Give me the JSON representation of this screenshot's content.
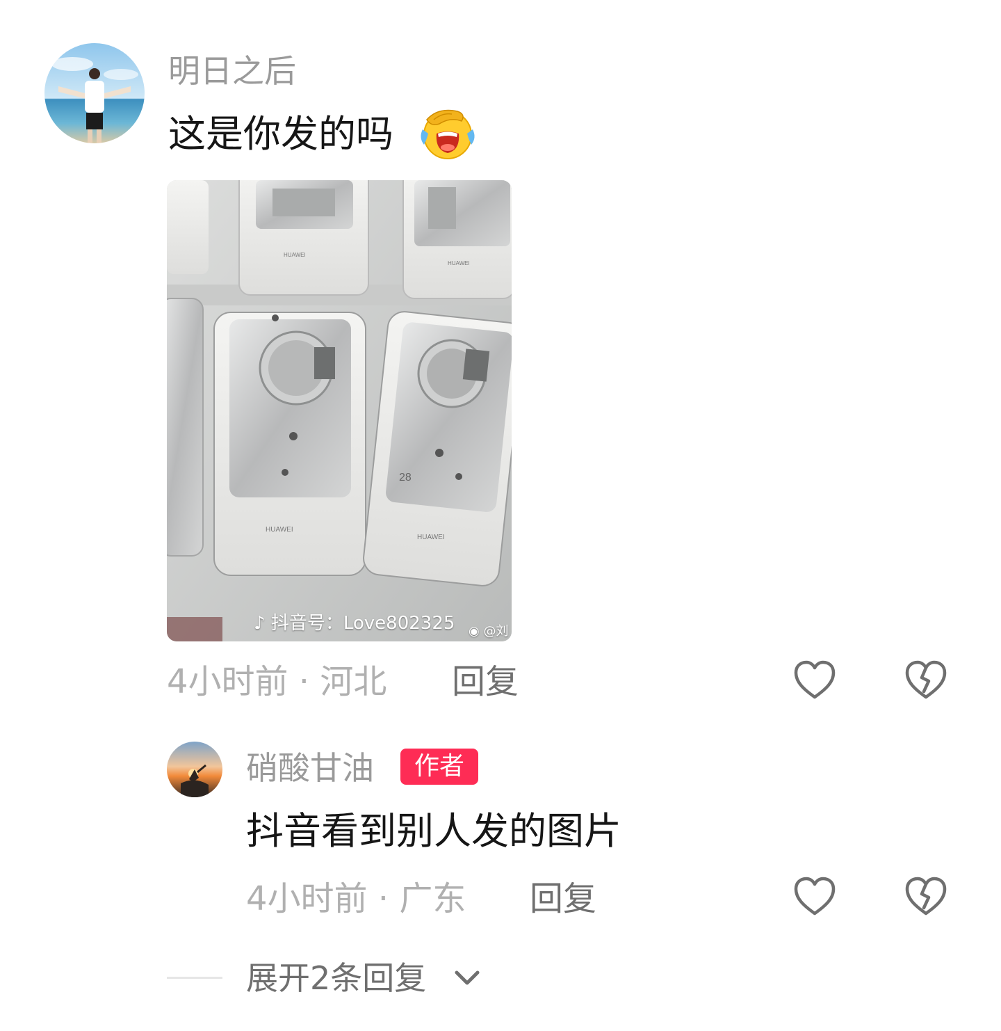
{
  "comments": [
    {
      "username": "明日之后",
      "text": "这是你发的吗",
      "emoji": "facepalm-laugh-emoji",
      "image": {
        "product_label": "HUAWEI",
        "unit_number": "28",
        "watermark": "抖音号：Love802325",
        "watermark2": "@刘"
      },
      "meta": "4小时前 · 河北",
      "reply_label": "回复"
    },
    {
      "username": "硝酸甘油",
      "badge": "作者",
      "text": "抖音看到别人发的图片",
      "meta": "4小时前 · 广东",
      "reply_label": "回复"
    }
  ],
  "expand_label": "展开2条回复",
  "icons": {
    "like": "heart-outline-icon",
    "dislike": "broken-heart-icon",
    "expand": "chevron-down-icon"
  },
  "colors": {
    "author_badge": "#fe2c55",
    "primary_text": "#161616",
    "secondary_text": "#b0b0b0"
  }
}
